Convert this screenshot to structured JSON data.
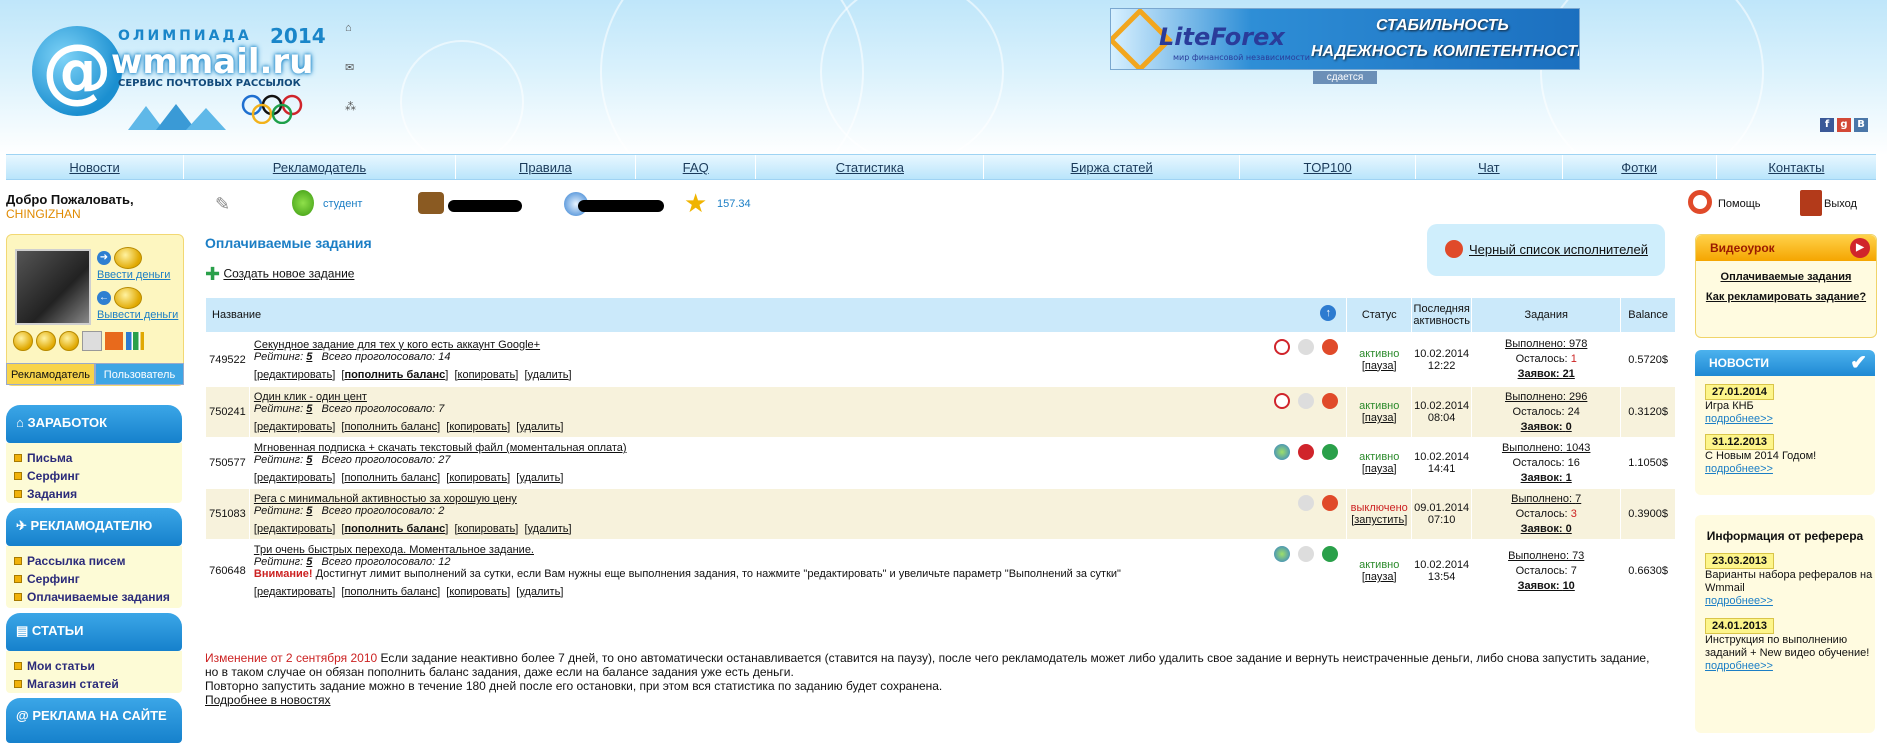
{
  "header": {
    "logo_top": "ОЛИМПИАДА",
    "logo_year": "2014",
    "logo_main": "wmmail.ru",
    "logo_sub": "СЕРВИС ПОЧТОВЫХ РАССЫЛОК",
    "banner_brand": "LiteForex",
    "banner_tagline": "мир финансовой независимости",
    "banner_w1": "СТАБИЛЬНОСТЬ",
    "banner_w2": "НАДЕЖНОСТЬ",
    "banner_w3": "КОМПЕТЕНТНОСТЬ",
    "banner_sub": "сдается"
  },
  "nav": [
    "Новости",
    "Рекламодатель",
    "Правила",
    "FAQ",
    "Статистика",
    "Биржа статей",
    "TOP100",
    "Чат",
    "Фотки",
    "Контакты"
  ],
  "userbar": {
    "welcome": "Добро Пожаловать,",
    "username": "CHINGIZHAN",
    "status": "студент",
    "rating": "157.34",
    "help": "Помощь",
    "logout": "Выход"
  },
  "leftpanel": {
    "deposit": "Ввести деньги",
    "withdraw": "Вывести деньги",
    "tab_advertiser": "Рекламодатель",
    "tab_user": "Пользователь"
  },
  "sections": [
    {
      "title": "ЗАРАБОТОК",
      "items": [
        "Письма",
        "Серфинг",
        "Задания"
      ]
    },
    {
      "title": "РЕКЛАМОДАТЕЛЮ",
      "items": [
        "Рассылка писем",
        "Серфинг",
        "Оплачиваемые задания"
      ]
    },
    {
      "title": "СТАТЬИ",
      "items": [
        "Мои статьи",
        "Магазин статей"
      ]
    },
    {
      "title": "РЕКЛАМА НА САЙТЕ",
      "items": []
    }
  ],
  "main": {
    "title": "Оплачиваемые задания",
    "create": "Создать новое задание",
    "blacklist": "Черный список исполнителей",
    "columns": {
      "name": "Название",
      "status": "Статус",
      "last": "Последняя активность",
      "tasks": "Задания",
      "balance": "Balance"
    },
    "actions": {
      "edit": "редактировать",
      "fund": "пополнить баланс",
      "copy": "копировать",
      "del": "удалить"
    },
    "rating_label": "Рейтинг:",
    "votes_label": "Всего проголосовало:",
    "done_label": "Выполнено:",
    "left_label": "Осталось:",
    "req_label": "Заявок:",
    "rows": [
      {
        "id": "749522",
        "title": "Секундное задание для тех у кого есть аккаунт Google+",
        "rating": "5",
        "votes": "14",
        "status": "активно",
        "toggle": "пауза",
        "date": "10.02.2014",
        "time": "12:22",
        "done": "978",
        "left": "1",
        "req": "21",
        "balance": "0.5720$"
      },
      {
        "id": "750241",
        "title": "Один клик - один цент",
        "rating": "5",
        "votes": "7",
        "status": "активно",
        "toggle": "пауза",
        "date": "10.02.2014",
        "time": "08:04",
        "done": "296",
        "left": "24",
        "req": "0",
        "balance": "0.3120$"
      },
      {
        "id": "750577",
        "title": "Мгновенная подписка + скачать текстовый файл (моментальная оплата)",
        "rating": "5",
        "votes": "27",
        "status": "активно",
        "toggle": "пауза",
        "date": "10.02.2014",
        "time": "14:41",
        "done": "1043",
        "left": "16",
        "req": "1",
        "balance": "1.1050$"
      },
      {
        "id": "751083",
        "title": "Рега с минимальной активностью за хорошую цену",
        "rating": "5",
        "votes": "2",
        "status": "выключено",
        "toggle": "запустить",
        "date": "09.01.2014",
        "time": "07:10",
        "done": "7",
        "left": "3",
        "req": "0",
        "balance": "0.3900$"
      },
      {
        "id": "760648",
        "title": "Три очень быстрых перехода. Моментальное задание.",
        "rating": "5",
        "votes": "12",
        "status": "активно",
        "toggle": "пауза",
        "date": "10.02.2014",
        "time": "13:54",
        "done": "73",
        "left": "7",
        "req": "10",
        "balance": "0.6630$",
        "warning_label": "Внимание!",
        "warning": "Достигнут лимит выполнений за сутки, если Вам нужны еще выполнения задания, то нажмите \"редактировать\" и увеличьте параметр \"Выполнений за сутки\""
      }
    ],
    "notice_date": "Изменение от 2 сентября 2010",
    "notice_text1": "Если задание неактивно более 7 дней, то оно автоматически останавливается (ставится на паузу), после чего рекламодатель может либо удалить свое задание и вернуть неистраченные деньги, либо снова запустить задание, но в таком случае он обязан пополнить баланс задания, даже если на балансе задания уже есть деньги.",
    "notice_text2": "Повторно запустить задание можно в течение 180 дней после его остановки, при этом вся статистика по заданию будет сохранена.",
    "notice_more": "Подробнее в новостях"
  },
  "right": {
    "video_title": "Видеоурок",
    "video_link1": "Оплачиваемые задания",
    "video_link2": "Как рекламировать задание?",
    "news_title": "НОВОСТИ",
    "news": [
      {
        "date": "27.01.2014",
        "text": "Игра КНБ",
        "more": "подробнее>>"
      },
      {
        "date": "31.12.2013",
        "text": "С Новым 2014 Годом!",
        "more": "подробнее>>"
      }
    ],
    "ref_title": "Информация от реферера",
    "ref": [
      {
        "date": "23.03.2013",
        "text": "Варианты набора рефералов на Wmmail",
        "more": "подробнее>>"
      },
      {
        "date": "24.01.2013",
        "text": "Инструкция по выполнению заданий + New видео обучение!",
        "more": "подробнее>>"
      }
    ]
  }
}
